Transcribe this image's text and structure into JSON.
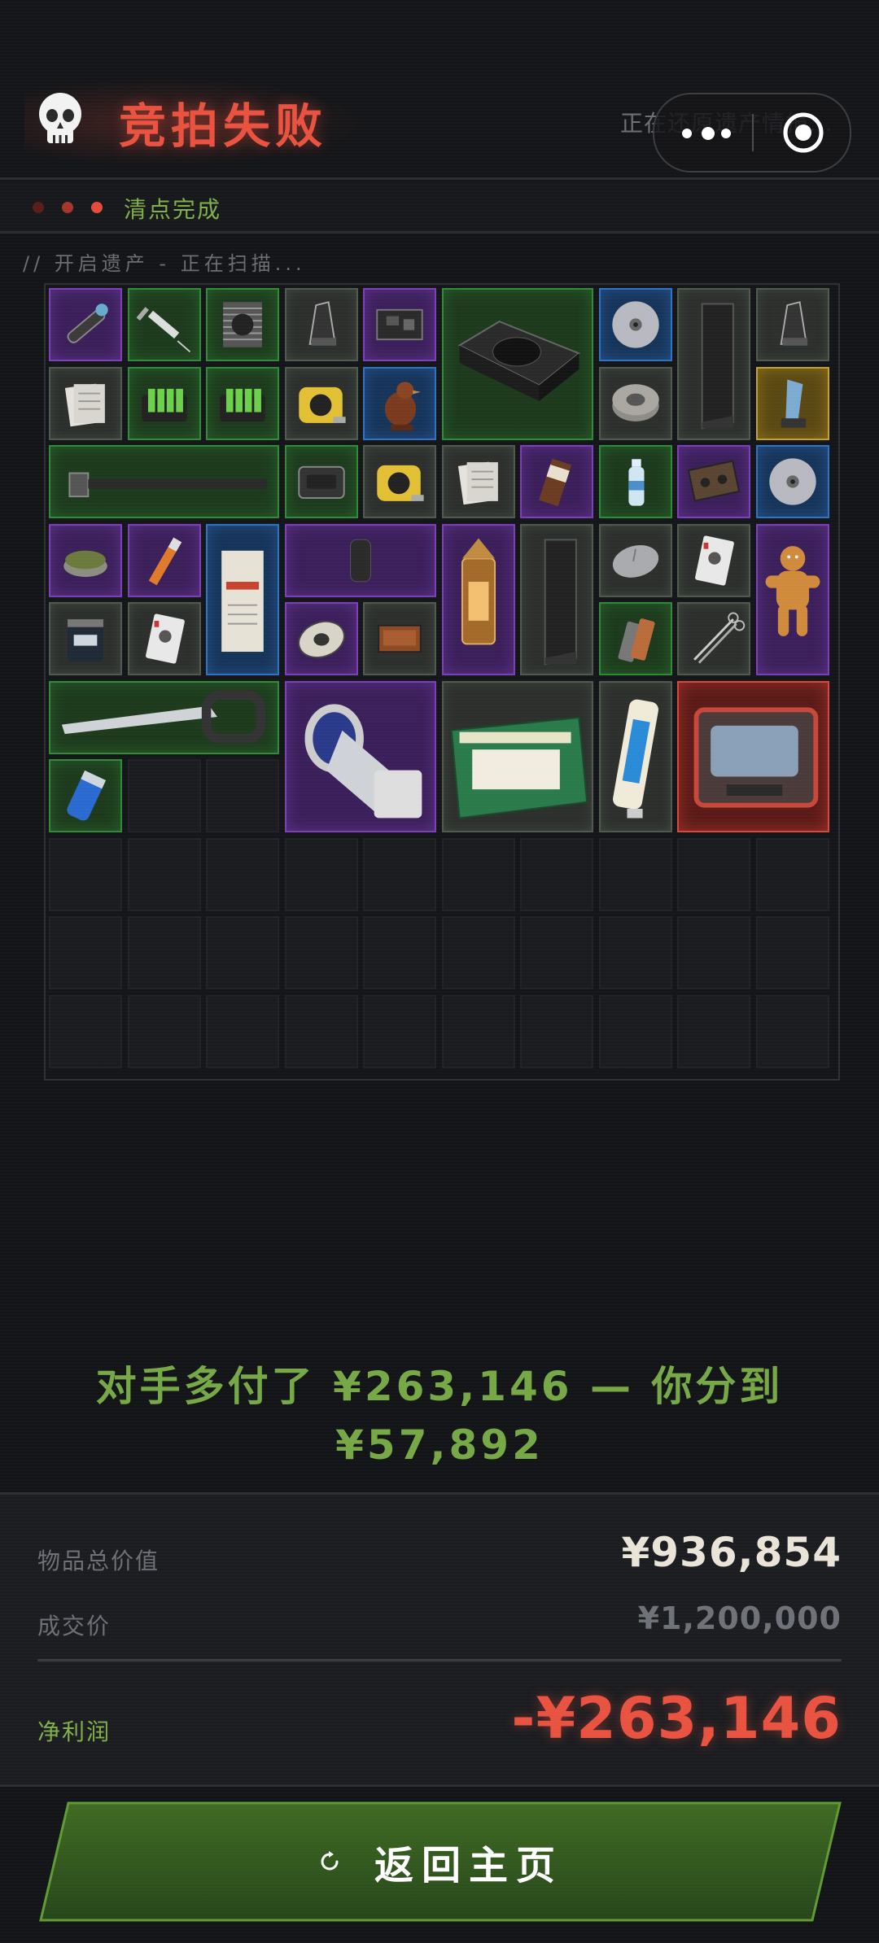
{
  "header": {
    "title": "竞拍失败",
    "restore_text": "正在还原遗产情报..."
  },
  "status": {
    "done_text": "清点完成",
    "scan_text": "// 开启遗产 - 正在扫描..."
  },
  "colors": {
    "loss_red": "#e9523f",
    "gain_green": "#76a846",
    "rarity": {
      "green": "#2f8a36",
      "purple": "#7b3fb8",
      "blue": "#2f72c3",
      "gray": "#4e5a4e",
      "gold": "#c4a12a",
      "red": "#d8473a"
    }
  },
  "grid": {
    "columns": 10,
    "rows": 10,
    "items": [
      {
        "name": "flashlight",
        "rarity": "purple",
        "col": 0,
        "row": 0,
        "w": 1,
        "h": 1
      },
      {
        "name": "syringe",
        "rarity": "green",
        "col": 1,
        "row": 0,
        "w": 1,
        "h": 1
      },
      {
        "name": "cpu-cooler",
        "rarity": "green",
        "col": 2,
        "row": 0,
        "w": 1,
        "h": 1
      },
      {
        "name": "pepper-grinder",
        "rarity": "gray",
        "col": 3,
        "row": 0,
        "w": 1,
        "h": 1
      },
      {
        "name": "circuit-board",
        "rarity": "purple",
        "col": 4,
        "row": 0,
        "w": 1,
        "h": 1
      },
      {
        "name": "power-supply",
        "rarity": "green",
        "col": 5,
        "row": 0,
        "w": 2,
        "h": 2
      },
      {
        "name": "cd-disc",
        "rarity": "blue",
        "col": 7,
        "row": 0,
        "w": 1,
        "h": 1
      },
      {
        "name": "steel-angle",
        "rarity": "gray",
        "col": 8,
        "row": 0,
        "w": 1,
        "h": 2
      },
      {
        "name": "pepper-grinder",
        "rarity": "gray",
        "col": 9,
        "row": 0,
        "w": 1,
        "h": 1
      },
      {
        "name": "documents",
        "rarity": "gray",
        "col": 0,
        "row": 1,
        "w": 1,
        "h": 1
      },
      {
        "name": "battery-charger",
        "rarity": "green",
        "col": 1,
        "row": 1,
        "w": 1,
        "h": 1
      },
      {
        "name": "battery-charger",
        "rarity": "green",
        "col": 2,
        "row": 1,
        "w": 1,
        "h": 1
      },
      {
        "name": "tape-measure",
        "rarity": "gray",
        "col": 3,
        "row": 1,
        "w": 1,
        "h": 1
      },
      {
        "name": "bird-figurine",
        "rarity": "blue",
        "col": 4,
        "row": 1,
        "w": 1,
        "h": 1
      },
      {
        "name": "duct-tape",
        "rarity": "gray",
        "col": 7,
        "row": 1,
        "w": 1,
        "h": 1
      },
      {
        "name": "crystal-trophy",
        "rarity": "gold",
        "col": 9,
        "row": 1,
        "w": 1,
        "h": 1
      },
      {
        "name": "sledgehammer",
        "rarity": "green",
        "col": 0,
        "row": 2,
        "w": 3,
        "h": 1
      },
      {
        "name": "hard-drive",
        "rarity": "green",
        "col": 3,
        "row": 2,
        "w": 1,
        "h": 1
      },
      {
        "name": "tape-measure",
        "rarity": "gray",
        "col": 4,
        "row": 2,
        "w": 1,
        "h": 1
      },
      {
        "name": "documents",
        "rarity": "gray",
        "col": 5,
        "row": 2,
        "w": 1,
        "h": 1
      },
      {
        "name": "chocolate-bar",
        "rarity": "purple",
        "col": 6,
        "row": 2,
        "w": 1,
        "h": 1
      },
      {
        "name": "water-bottle",
        "rarity": "green",
        "col": 7,
        "row": 2,
        "w": 1,
        "h": 1
      },
      {
        "name": "cassette-tape",
        "rarity": "purple",
        "col": 8,
        "row": 2,
        "w": 1,
        "h": 1
      },
      {
        "name": "cd-disc",
        "rarity": "blue",
        "col": 9,
        "row": 2,
        "w": 1,
        "h": 1
      },
      {
        "name": "canned-food",
        "rarity": "purple",
        "col": 0,
        "row": 3,
        "w": 1,
        "h": 1
      },
      {
        "name": "lighter-stick",
        "rarity": "purple",
        "col": 1,
        "row": 3,
        "w": 1,
        "h": 1
      },
      {
        "name": "confidential-folder",
        "rarity": "blue",
        "col": 2,
        "row": 3,
        "w": 1,
        "h": 2
      },
      {
        "name": "whetstone",
        "rarity": "purple",
        "col": 3,
        "row": 3,
        "w": 2,
        "h": 1
      },
      {
        "name": "lantern",
        "rarity": "purple",
        "col": 5,
        "row": 3,
        "w": 1,
        "h": 2
      },
      {
        "name": "steel-angle",
        "rarity": "gray",
        "col": 6,
        "row": 3,
        "w": 1,
        "h": 2
      },
      {
        "name": "computer-mouse",
        "rarity": "gray",
        "col": 7,
        "row": 3,
        "w": 1,
        "h": 1
      },
      {
        "name": "playing-card",
        "rarity": "gray",
        "col": 8,
        "row": 3,
        "w": 1,
        "h": 1
      },
      {
        "name": "gingerbread-man",
        "rarity": "purple",
        "col": 9,
        "row": 3,
        "w": 1,
        "h": 2
      },
      {
        "name": "protein-can",
        "rarity": "gray",
        "col": 0,
        "row": 4,
        "w": 1,
        "h": 1
      },
      {
        "name": "playing-card",
        "rarity": "gray",
        "col": 1,
        "row": 4,
        "w": 1,
        "h": 1
      },
      {
        "name": "ornate-egg",
        "rarity": "purple",
        "col": 3,
        "row": 4,
        "w": 1,
        "h": 1
      },
      {
        "name": "matchbox",
        "rarity": "gray",
        "col": 4,
        "row": 4,
        "w": 1,
        "h": 1
      },
      {
        "name": "lighters",
        "rarity": "green",
        "col": 7,
        "row": 4,
        "w": 1,
        "h": 1
      },
      {
        "name": "scissors",
        "rarity": "gray",
        "col": 8,
        "row": 4,
        "w": 1,
        "h": 1
      },
      {
        "name": "hand-saw",
        "rarity": "green",
        "col": 0,
        "row": 5,
        "w": 3,
        "h": 1
      },
      {
        "name": "telescope-device",
        "rarity": "purple",
        "col": 3,
        "row": 5,
        "w": 2,
        "h": 2
      },
      {
        "name": "candle-box",
        "rarity": "gray",
        "col": 5,
        "row": 5,
        "w": 2,
        "h": 2
      },
      {
        "name": "toothpaste",
        "rarity": "gray",
        "col": 7,
        "row": 5,
        "w": 1,
        "h": 2
      },
      {
        "name": "radio-unit",
        "rarity": "red",
        "col": 8,
        "row": 5,
        "w": 2,
        "h": 2
      },
      {
        "name": "capacitor",
        "rarity": "green",
        "col": 0,
        "row": 6,
        "w": 1,
        "h": 1
      }
    ]
  },
  "message": {
    "line1": "对手多付了 ¥263,146 — 你分到",
    "line2": "¥57,892"
  },
  "summary": {
    "total_label": "物品总价值",
    "total_value": "¥936,854",
    "deal_label": "成交价",
    "deal_value": "¥1,200,000",
    "profit_label": "净利润",
    "profit_value": "-¥263,146"
  },
  "button": {
    "label": "返回主页"
  }
}
